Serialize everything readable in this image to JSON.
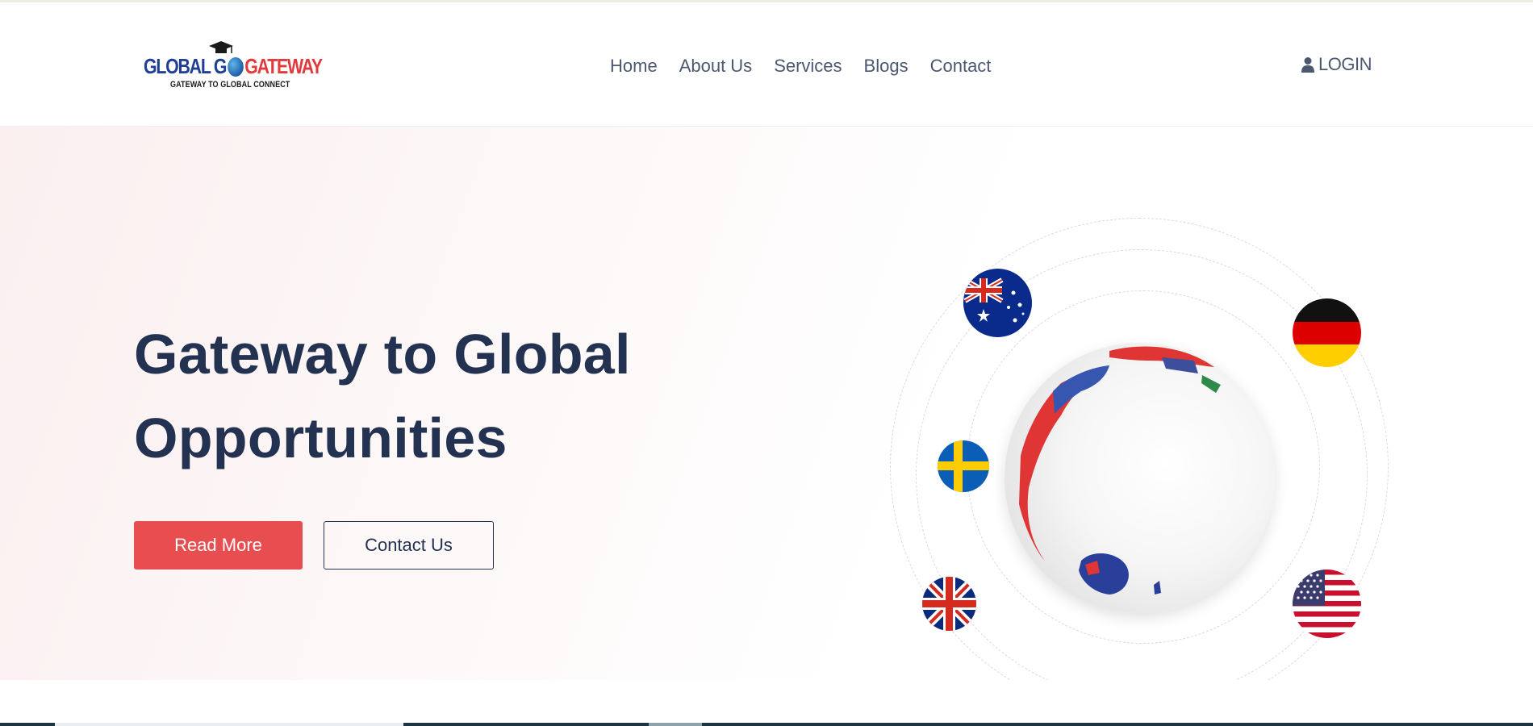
{
  "brand": {
    "title_part1": "GLOBAL G",
    "title_part2": "GATEWAY",
    "tagline": "GATEWAY TO GLOBAL CONNECT",
    "colors": {
      "blue": "#1f3f96",
      "red": "#e23a3a"
    }
  },
  "nav": {
    "items": [
      {
        "label": "Home"
      },
      {
        "label": "About Us"
      },
      {
        "label": "Services"
      },
      {
        "label": "Blogs"
      },
      {
        "label": "Contact"
      }
    ],
    "login_label": "LOGIN",
    "login_icon": "user-icon"
  },
  "hero": {
    "heading_line1": "Gateway to Global",
    "heading_line2": "Opportunities",
    "primary_button": "Read More",
    "secondary_button": "Contact Us",
    "flags": [
      "australia",
      "germany",
      "sweden",
      "united-kingdom",
      "united-states"
    ]
  },
  "colors": {
    "accent": "#e84e50",
    "heading": "#233250",
    "nav_text": "#4b5870"
  }
}
